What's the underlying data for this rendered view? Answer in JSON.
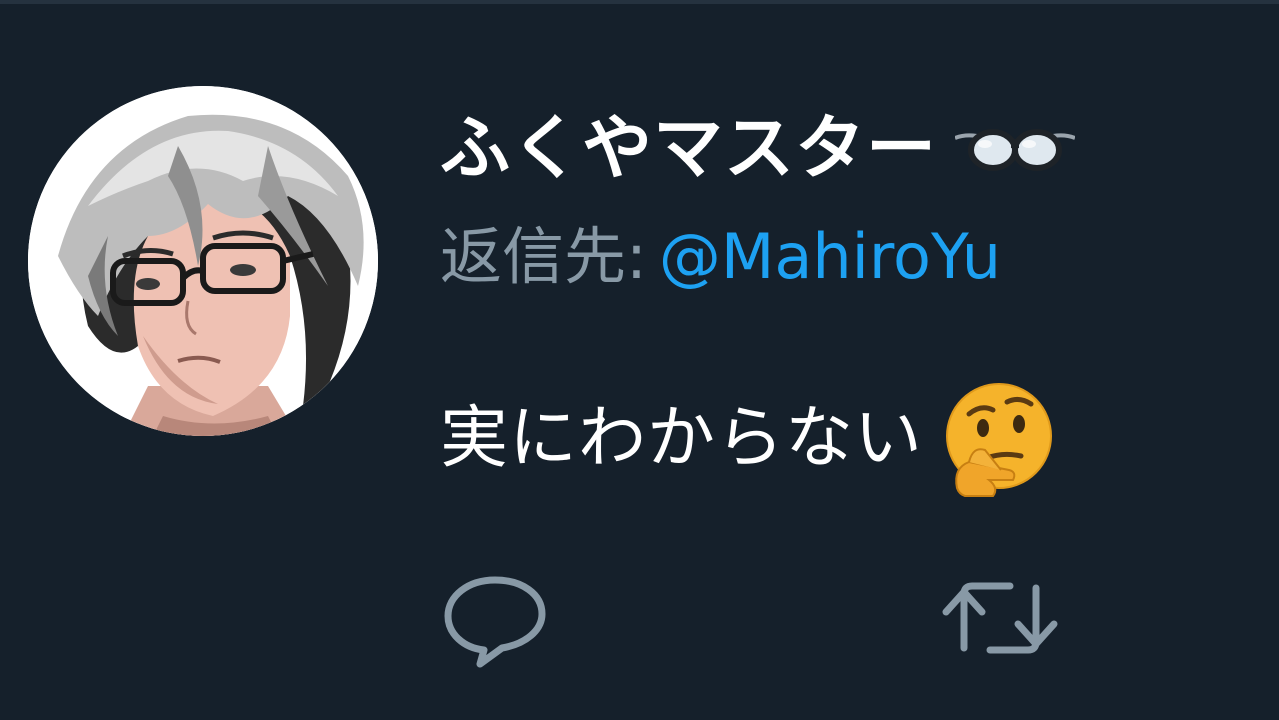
{
  "tweet": {
    "author": {
      "display_name": "ふくやマスター",
      "name_emoji": "glasses-emoji",
      "avatar": "anime-style-avatar"
    },
    "reply": {
      "prefix": "返信先:",
      "handle": "@MahiroYu"
    },
    "text": "実にわからない",
    "text_emoji": "thinking-face-emoji"
  },
  "actions": {
    "reply_icon": "reply-icon",
    "retweet_icon": "retweet-icon"
  },
  "colors": {
    "background": "#15202b",
    "text_primary": "#ffffff",
    "text_secondary": "#8899a6",
    "link": "#1da1f2",
    "icon": "#8899a6"
  }
}
